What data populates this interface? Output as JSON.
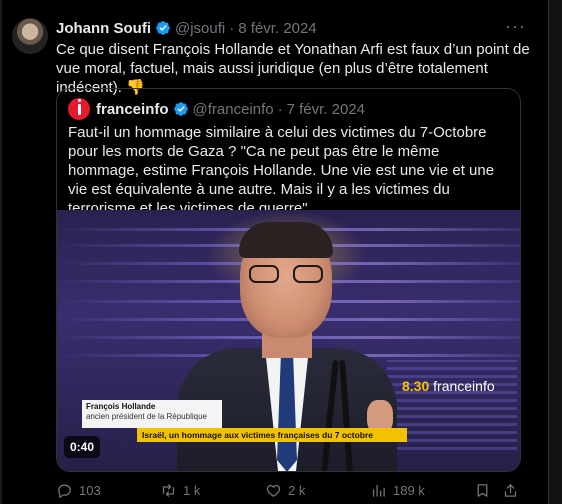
{
  "author": {
    "name": "Johann Soufi",
    "handle": "@jsoufi",
    "date": "8 févr. 2024",
    "separator": "·"
  },
  "tweet": {
    "text": "Ce que disent François Hollande et Yonathan Arfi est faux d’un point de vue moral, factuel, mais aussi juridique (en plus d’être totalement indécent). 👎"
  },
  "more_label": "···",
  "quoted": {
    "name": "franceinfo",
    "handle": "@franceinfo",
    "date": "7 févr. 2024",
    "separator": "·",
    "text": "Faut-il un hommage similaire à celui des victimes du 7-Octobre pour les morts de Gaza ?  \"Ca ne peut pas être le même hommage, estime François Hollande. Une vie est une vie et une vie est équivalente à une autre. Mais il y a les victimes du terrorisme et les victimes de guerre\".",
    "video": {
      "brand_time": "8.30",
      "brand_name": "franceinfo",
      "lower_third_name": "François Hollande",
      "lower_third_role": "ancien président de la République",
      "banner": "Israël, un hommage aux victimes françaises du 7 octobre",
      "duration": "0:40"
    }
  },
  "actions": {
    "replies": "103",
    "retweets": "1 k",
    "likes": "2 k",
    "views": "189 k"
  },
  "colors": {
    "background": "#000000",
    "text": "#e7e9ea",
    "muted": "#71767b",
    "verified": "#1d9bf0",
    "franceinfo_red": "#e6192d",
    "banner_yellow": "#f2c200"
  }
}
